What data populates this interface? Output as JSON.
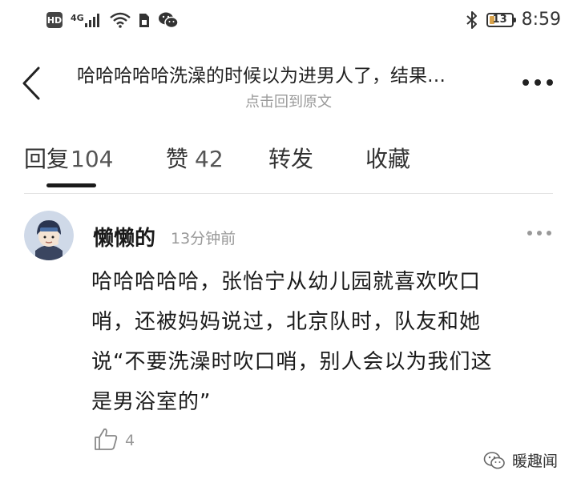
{
  "status_bar": {
    "hd_badge": "HD",
    "network": "4G",
    "battery_level": "13",
    "time": "8:59",
    "icons": [
      "hd-badge",
      "cell-signal-icon",
      "wifi-icon",
      "sim-card-icon",
      "wechat-icon",
      "bluetooth-icon",
      "battery-icon"
    ]
  },
  "header": {
    "title": "哈哈哈哈哈洗澡的时候以为进男人了，结果…",
    "subtitle": "点击回到原文",
    "back_icon": "chevron-left-icon",
    "more_icon": "more-horizontal-icon"
  },
  "tabs": [
    {
      "label": "回复",
      "count": "104",
      "active": true
    },
    {
      "label": "赞",
      "count": "42",
      "active": false
    },
    {
      "label": "转发",
      "count": "",
      "active": false
    },
    {
      "label": "收藏",
      "count": "",
      "active": false
    }
  ],
  "comment": {
    "username": "懒懒的",
    "time": "13分钟前",
    "lines": [
      "哈哈哈哈哈，张怡宁从幼儿园就喜欢吹口",
      "哨，还被妈妈说过，北京队时，队友和她",
      "说“不要洗澡时吹口哨，别人会以为我们这",
      "是男浴室的”"
    ],
    "likes": "4"
  },
  "watermark": {
    "text": "暖趣闻"
  },
  "colors": {
    "accent": "#1a1a1a",
    "muted": "#999999",
    "battery": "#d8a24a"
  }
}
